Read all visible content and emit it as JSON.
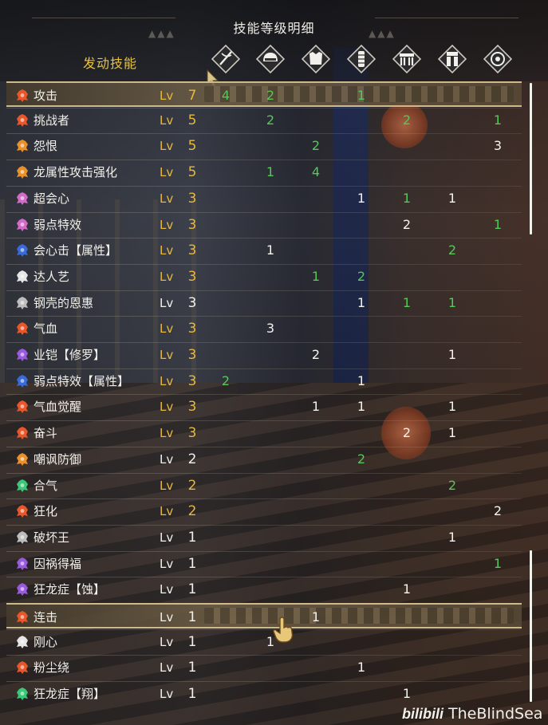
{
  "panel": {
    "title": "技能等级明细",
    "column_label": "发动技能",
    "level_prefix": "Lv"
  },
  "equipment_columns": [
    {
      "icon": "weapon-icon",
      "slot": "weapon"
    },
    {
      "icon": "helmet-icon",
      "slot": "head"
    },
    {
      "icon": "chest-armor-icon",
      "slot": "chest"
    },
    {
      "icon": "arm-armor-icon",
      "slot": "arms"
    },
    {
      "icon": "waist-armor-icon",
      "slot": "waist"
    },
    {
      "icon": "leg-armor-icon",
      "slot": "legs"
    },
    {
      "icon": "talisman-icon",
      "slot": "talisman"
    }
  ],
  "skills": [
    {
      "name": "攻击",
      "level": "7",
      "level_color": "gold",
      "icon_color": "#e8562a",
      "highlighted": true,
      "cells": [
        {
          "v": "4",
          "c": "green"
        },
        {
          "v": "2",
          "c": "green"
        },
        {
          "v": "",
          "c": ""
        },
        {
          "v": "1",
          "c": "green"
        },
        {
          "v": "",
          "c": ""
        },
        {
          "v": "",
          "c": ""
        },
        {
          "v": "",
          "c": ""
        }
      ]
    },
    {
      "name": "挑战者",
      "level": "5",
      "level_color": "gold",
      "icon_color": "#e8562a",
      "highlighted": false,
      "cells": [
        {
          "v": "",
          "c": ""
        },
        {
          "v": "2",
          "c": "green"
        },
        {
          "v": "",
          "c": ""
        },
        {
          "v": "",
          "c": ""
        },
        {
          "v": "2",
          "c": "green"
        },
        {
          "v": "",
          "c": ""
        },
        {
          "v": "1",
          "c": "green"
        }
      ]
    },
    {
      "name": "怨恨",
      "level": "5",
      "level_color": "gold",
      "icon_color": "#e8902a",
      "highlighted": false,
      "cells": [
        {
          "v": "",
          "c": ""
        },
        {
          "v": "",
          "c": ""
        },
        {
          "v": "2",
          "c": "green"
        },
        {
          "v": "",
          "c": ""
        },
        {
          "v": "",
          "c": ""
        },
        {
          "v": "",
          "c": ""
        },
        {
          "v": "3",
          "c": "white"
        }
      ]
    },
    {
      "name": "龙属性攻击强化",
      "level": "5",
      "level_color": "gold",
      "icon_color": "#e8902a",
      "highlighted": false,
      "cells": [
        {
          "v": "",
          "c": ""
        },
        {
          "v": "1",
          "c": "green"
        },
        {
          "v": "4",
          "c": "green"
        },
        {
          "v": "",
          "c": ""
        },
        {
          "v": "",
          "c": ""
        },
        {
          "v": "",
          "c": ""
        },
        {
          "v": "",
          "c": ""
        }
      ]
    },
    {
      "name": "超会心",
      "level": "3",
      "level_color": "gold",
      "icon_color": "#d46ac8",
      "highlighted": false,
      "cells": [
        {
          "v": "",
          "c": ""
        },
        {
          "v": "",
          "c": ""
        },
        {
          "v": "",
          "c": ""
        },
        {
          "v": "1",
          "c": "white"
        },
        {
          "v": "1",
          "c": "green"
        },
        {
          "v": "1",
          "c": "white"
        },
        {
          "v": "",
          "c": ""
        }
      ]
    },
    {
      "name": "弱点特效",
      "level": "3",
      "level_color": "gold",
      "icon_color": "#d46ac8",
      "highlighted": false,
      "cells": [
        {
          "v": "",
          "c": ""
        },
        {
          "v": "",
          "c": ""
        },
        {
          "v": "",
          "c": ""
        },
        {
          "v": "",
          "c": ""
        },
        {
          "v": "2",
          "c": "white"
        },
        {
          "v": "",
          "c": ""
        },
        {
          "v": "1",
          "c": "green"
        }
      ]
    },
    {
      "name": "会心击【属性】",
      "level": "3",
      "level_color": "gold",
      "icon_color": "#3a6ad8",
      "highlighted": false,
      "cells": [
        {
          "v": "",
          "c": ""
        },
        {
          "v": "1",
          "c": "white"
        },
        {
          "v": "",
          "c": ""
        },
        {
          "v": "",
          "c": ""
        },
        {
          "v": "",
          "c": ""
        },
        {
          "v": "2",
          "c": "green"
        },
        {
          "v": "",
          "c": ""
        }
      ]
    },
    {
      "name": "达人艺",
      "level": "3",
      "level_color": "gold",
      "icon_color": "#e6e6e6",
      "highlighted": false,
      "cells": [
        {
          "v": "",
          "c": ""
        },
        {
          "v": "",
          "c": ""
        },
        {
          "v": "1",
          "c": "green"
        },
        {
          "v": "2",
          "c": "green"
        },
        {
          "v": "",
          "c": ""
        },
        {
          "v": "",
          "c": ""
        },
        {
          "v": "",
          "c": ""
        }
      ]
    },
    {
      "name": "钢壳的恩惠",
      "level": "3",
      "level_color": "white",
      "icon_color": "#bdbdbd",
      "highlighted": false,
      "cells": [
        {
          "v": "",
          "c": ""
        },
        {
          "v": "",
          "c": ""
        },
        {
          "v": "",
          "c": ""
        },
        {
          "v": "1",
          "c": "white"
        },
        {
          "v": "1",
          "c": "green"
        },
        {
          "v": "1",
          "c": "green"
        },
        {
          "v": "",
          "c": ""
        }
      ]
    },
    {
      "name": "气血",
      "level": "3",
      "level_color": "gold",
      "icon_color": "#e8562a",
      "highlighted": false,
      "cells": [
        {
          "v": "",
          "c": ""
        },
        {
          "v": "3",
          "c": "white"
        },
        {
          "v": "",
          "c": ""
        },
        {
          "v": "",
          "c": ""
        },
        {
          "v": "",
          "c": ""
        },
        {
          "v": "",
          "c": ""
        },
        {
          "v": "",
          "c": ""
        }
      ]
    },
    {
      "name": "业铠【修罗】",
      "level": "3",
      "level_color": "gold",
      "icon_color": "#9a5ae0",
      "highlighted": false,
      "cells": [
        {
          "v": "",
          "c": ""
        },
        {
          "v": "",
          "c": ""
        },
        {
          "v": "2",
          "c": "white"
        },
        {
          "v": "",
          "c": ""
        },
        {
          "v": "",
          "c": ""
        },
        {
          "v": "1",
          "c": "white"
        },
        {
          "v": "",
          "c": ""
        }
      ]
    },
    {
      "name": "弱点特效【属性】",
      "level": "3",
      "level_color": "gold",
      "icon_color": "#3a6ad8",
      "highlighted": false,
      "cells": [
        {
          "v": "2",
          "c": "green"
        },
        {
          "v": "",
          "c": ""
        },
        {
          "v": "",
          "c": ""
        },
        {
          "v": "1",
          "c": "white"
        },
        {
          "v": "",
          "c": ""
        },
        {
          "v": "",
          "c": ""
        },
        {
          "v": "",
          "c": ""
        }
      ]
    },
    {
      "name": "气血觉醒",
      "level": "3",
      "level_color": "gold",
      "icon_color": "#e8562a",
      "highlighted": false,
      "cells": [
        {
          "v": "",
          "c": ""
        },
        {
          "v": "",
          "c": ""
        },
        {
          "v": "1",
          "c": "white"
        },
        {
          "v": "1",
          "c": "white"
        },
        {
          "v": "",
          "c": ""
        },
        {
          "v": "1",
          "c": "white"
        },
        {
          "v": "",
          "c": ""
        }
      ]
    },
    {
      "name": "奋斗",
      "level": "3",
      "level_color": "gold",
      "icon_color": "#e8562a",
      "highlighted": false,
      "cells": [
        {
          "v": "",
          "c": ""
        },
        {
          "v": "",
          "c": ""
        },
        {
          "v": "",
          "c": ""
        },
        {
          "v": "",
          "c": ""
        },
        {
          "v": "2",
          "c": "white"
        },
        {
          "v": "1",
          "c": "white"
        },
        {
          "v": "",
          "c": ""
        }
      ]
    },
    {
      "name": "嘲讽防御",
      "level": "2",
      "level_color": "white",
      "icon_color": "#e8902a",
      "highlighted": false,
      "cells": [
        {
          "v": "",
          "c": ""
        },
        {
          "v": "",
          "c": ""
        },
        {
          "v": "",
          "c": ""
        },
        {
          "v": "2",
          "c": "green"
        },
        {
          "v": "",
          "c": ""
        },
        {
          "v": "",
          "c": ""
        },
        {
          "v": "",
          "c": ""
        }
      ]
    },
    {
      "name": "合气",
      "level": "2",
      "level_color": "gold",
      "icon_color": "#3ac878",
      "highlighted": false,
      "cells": [
        {
          "v": "",
          "c": ""
        },
        {
          "v": "",
          "c": ""
        },
        {
          "v": "",
          "c": ""
        },
        {
          "v": "",
          "c": ""
        },
        {
          "v": "",
          "c": ""
        },
        {
          "v": "2",
          "c": "green"
        },
        {
          "v": "",
          "c": ""
        }
      ]
    },
    {
      "name": "狂化",
      "level": "2",
      "level_color": "gold",
      "icon_color": "#e8562a",
      "highlighted": false,
      "cells": [
        {
          "v": "",
          "c": ""
        },
        {
          "v": "",
          "c": ""
        },
        {
          "v": "",
          "c": ""
        },
        {
          "v": "",
          "c": ""
        },
        {
          "v": "",
          "c": ""
        },
        {
          "v": "",
          "c": ""
        },
        {
          "v": "2",
          "c": "white"
        }
      ]
    },
    {
      "name": "破坏王",
      "level": "1",
      "level_color": "white",
      "icon_color": "#bdbdbd",
      "highlighted": false,
      "cells": [
        {
          "v": "",
          "c": ""
        },
        {
          "v": "",
          "c": ""
        },
        {
          "v": "",
          "c": ""
        },
        {
          "v": "",
          "c": ""
        },
        {
          "v": "",
          "c": ""
        },
        {
          "v": "1",
          "c": "white"
        },
        {
          "v": "",
          "c": ""
        }
      ]
    },
    {
      "name": "因祸得福",
      "level": "1",
      "level_color": "white",
      "icon_color": "#9a5ae0",
      "highlighted": false,
      "cells": [
        {
          "v": "",
          "c": ""
        },
        {
          "v": "",
          "c": ""
        },
        {
          "v": "",
          "c": ""
        },
        {
          "v": "",
          "c": ""
        },
        {
          "v": "",
          "c": ""
        },
        {
          "v": "",
          "c": ""
        },
        {
          "v": "1",
          "c": "green"
        }
      ]
    },
    {
      "name": "狂龙症【蚀】",
      "level": "1",
      "level_color": "white",
      "icon_color": "#9a5ae0",
      "highlighted": false,
      "cells": [
        {
          "v": "",
          "c": ""
        },
        {
          "v": "",
          "c": ""
        },
        {
          "v": "",
          "c": ""
        },
        {
          "v": "",
          "c": ""
        },
        {
          "v": "1",
          "c": "white"
        },
        {
          "v": "",
          "c": ""
        },
        {
          "v": "",
          "c": ""
        }
      ]
    },
    {
      "name": "连击",
      "level": "1",
      "level_color": "white",
      "icon_color": "#e8562a",
      "highlighted": true,
      "cells": [
        {
          "v": "",
          "c": ""
        },
        {
          "v": "",
          "c": ""
        },
        {
          "v": "1",
          "c": "white"
        },
        {
          "v": "",
          "c": ""
        },
        {
          "v": "",
          "c": ""
        },
        {
          "v": "",
          "c": ""
        },
        {
          "v": "",
          "c": ""
        }
      ]
    },
    {
      "name": "刚心",
      "level": "1",
      "level_color": "white",
      "icon_color": "#e6e6e6",
      "highlighted": false,
      "cells": [
        {
          "v": "",
          "c": ""
        },
        {
          "v": "1",
          "c": "white"
        },
        {
          "v": "",
          "c": ""
        },
        {
          "v": "",
          "c": ""
        },
        {
          "v": "",
          "c": ""
        },
        {
          "v": "",
          "c": ""
        },
        {
          "v": "",
          "c": ""
        }
      ]
    },
    {
      "name": "粉尘绕",
      "level": "1",
      "level_color": "white",
      "icon_color": "#e8562a",
      "highlighted": false,
      "cells": [
        {
          "v": "",
          "c": ""
        },
        {
          "v": "",
          "c": ""
        },
        {
          "v": "",
          "c": ""
        },
        {
          "v": "1",
          "c": "white"
        },
        {
          "v": "",
          "c": ""
        },
        {
          "v": "",
          "c": ""
        },
        {
          "v": "",
          "c": ""
        }
      ]
    },
    {
      "name": "狂龙症【翔】",
      "level": "1",
      "level_color": "white",
      "icon_color": "#3ac878",
      "highlighted": false,
      "cells": [
        {
          "v": "",
          "c": ""
        },
        {
          "v": "",
          "c": ""
        },
        {
          "v": "",
          "c": ""
        },
        {
          "v": "",
          "c": ""
        },
        {
          "v": "1",
          "c": "white"
        },
        {
          "v": "",
          "c": ""
        },
        {
          "v": "",
          "c": ""
        }
      ]
    }
  ],
  "watermark": {
    "logo": "bilibili",
    "text": "TheBlindSea"
  }
}
